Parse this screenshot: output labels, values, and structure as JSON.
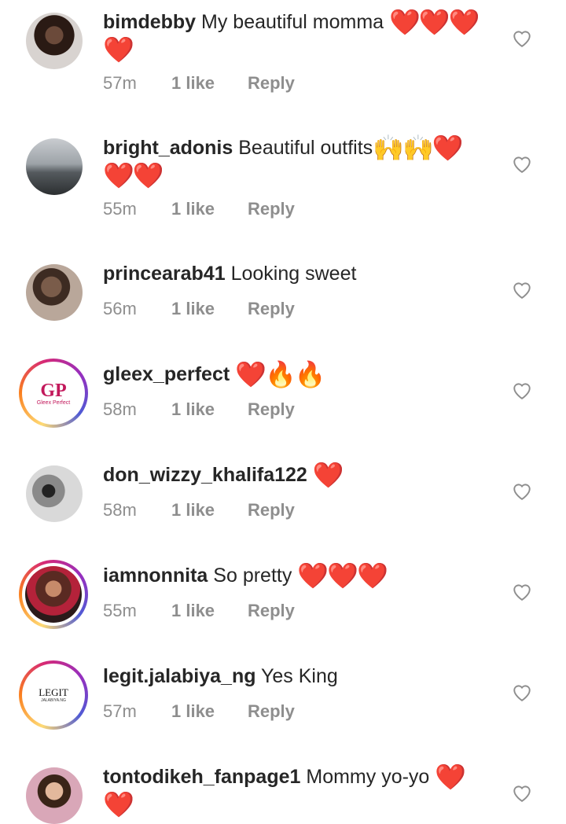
{
  "comments": [
    {
      "username": "bimdebby",
      "text": "My beautiful momma",
      "emoji": "❤️❤️❤️❤️",
      "time": "57m",
      "likes": "1 like",
      "reply": "Reply"
    },
    {
      "username": "bright_adonis",
      "text": "Beautiful outfits",
      "emoji": "🙌🙌❤️❤️❤️",
      "time": "55m",
      "likes": "1 like",
      "reply": "Reply"
    },
    {
      "username": "princearab41",
      "text": "Looking sweet",
      "emoji": "",
      "time": "56m",
      "likes": "1 like",
      "reply": "Reply"
    },
    {
      "username": "gleex_perfect",
      "text": "",
      "emoji": "❤️🔥🔥",
      "time": "58m",
      "likes": "1 like",
      "reply": "Reply",
      "avatar_logo": "GP",
      "avatar_caption": "Gleex Perfect"
    },
    {
      "username": "don_wizzy_khalifa122",
      "text": "",
      "emoji": "❤️",
      "time": "58m",
      "likes": "1 like",
      "reply": "Reply"
    },
    {
      "username": "iamnonnita",
      "text": "So pretty",
      "emoji": "❤️❤️❤️",
      "time": "55m",
      "likes": "1 like",
      "reply": "Reply"
    },
    {
      "username": "legit.jalabiya_ng",
      "text": "Yes King",
      "emoji": "",
      "time": "57m",
      "likes": "1 like",
      "reply": "Reply",
      "avatar_logo": "LEGIT",
      "avatar_caption": "JALABIYA.NG"
    },
    {
      "username": "tontodikeh_fanpage1",
      "text": "Mommy yo-yo",
      "emoji": "❤️❤️",
      "time": "",
      "likes": "",
      "reply": ""
    }
  ],
  "icons": {
    "like": "heart-outline-icon"
  },
  "colors": {
    "heart": "#ed1c24",
    "meta": "#8e8e8e",
    "text": "#262626"
  }
}
